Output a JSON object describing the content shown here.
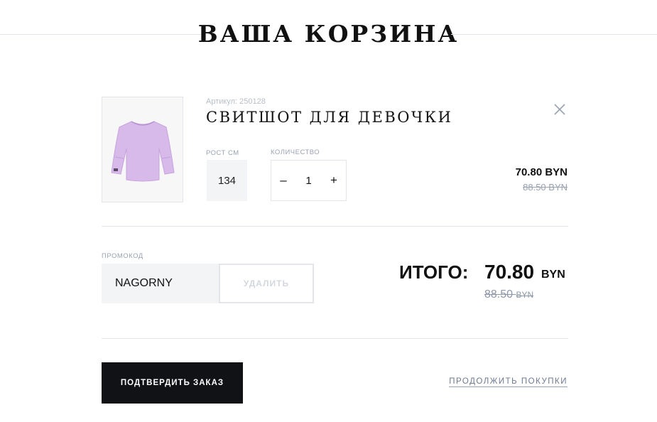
{
  "page": {
    "title": "ВАША КОРЗИНА"
  },
  "cart_item": {
    "article": "Артикул: 250128",
    "name": "СВИТШОТ ДЛЯ ДЕВОЧКИ",
    "image_icon": "sweatshirt-icon",
    "size_label": "РОСТ СМ",
    "size_value": "134",
    "quantity_label": "КОЛИЧЕСТВО",
    "quantity_decrease": "–",
    "quantity_value": "1",
    "quantity_increase": "+",
    "price": "70.80 BYN",
    "old_price": "88.50 BYN",
    "remove_icon": "close-icon",
    "product_color": "#d7b9ea"
  },
  "promo": {
    "label": "ПРОМОКОД",
    "value": "NAGORNY",
    "remove_label": "УДАЛИТЬ"
  },
  "total": {
    "label": "ИТОГО:",
    "value": "70.80",
    "currency": "BYN",
    "old_value": "88.50",
    "old_currency": "BYN"
  },
  "actions": {
    "confirm_label": "ПОДТВЕРДИТЬ ЗАКАЗ",
    "continue_label": "ПРОДОЛЖИТЬ ПОКУПКИ"
  },
  "colors": {
    "primary_button": "#111216",
    "divider": "#e3e5ea",
    "muted_text": "#9aa2b1"
  }
}
